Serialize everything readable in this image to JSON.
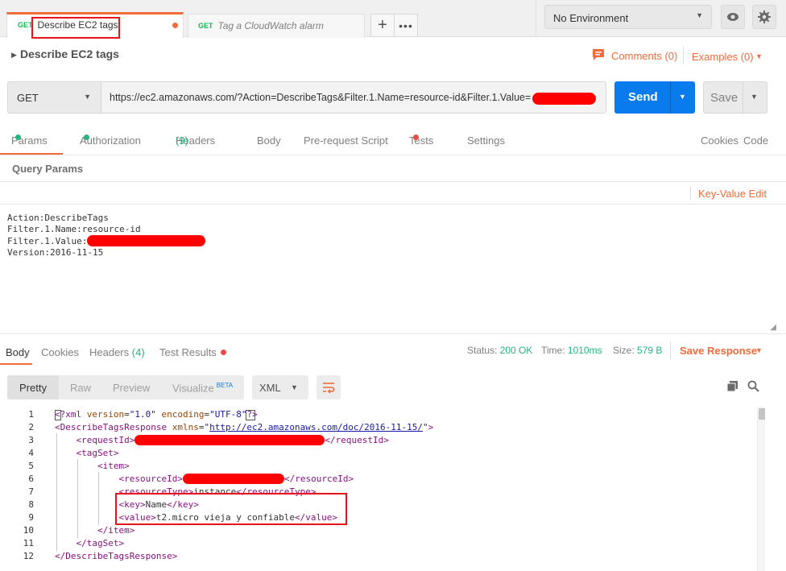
{
  "tabs": [
    {
      "method": "GET",
      "name": "Describe EC2 tags"
    },
    {
      "method": "GET",
      "name": "Tag a CloudWatch alarm"
    }
  ],
  "environment": {
    "selected": "No Environment"
  },
  "request": {
    "title": "Describe EC2 tags",
    "comments_label": "Comments (0)",
    "examples_label": "Examples (0)",
    "method": "GET",
    "url": "https://ec2.amazonaws.com/?Action=DescribeTags&Filter.1.Name=resource-id&Filter.1.Value=",
    "send_label": "Send",
    "save_label": "Save"
  },
  "request_tabs": {
    "params": "Params",
    "authorization": "Authorization",
    "headers": "Headers",
    "headers_count": "(9)",
    "body": "Body",
    "prerequest": "Pre-request Script",
    "tests": "Tests",
    "settings": "Settings",
    "cookies": "Cookies",
    "code": "Code"
  },
  "query_params": {
    "title": "Query Params",
    "key_value_edit": "Key-Value Edit",
    "bulk_lines": [
      "Action:DescribeTags",
      "Filter.1.Name:resource-id",
      "Filter.1.Value:",
      "Version:2016-11-15"
    ]
  },
  "response": {
    "tabs": {
      "body": "Body",
      "cookies": "Cookies",
      "headers": "Headers",
      "headers_count": "(4)",
      "test_results": "Test Results"
    },
    "status_label": "Status:",
    "status_value": "200 OK",
    "time_label": "Time:",
    "time_value": "1010ms",
    "size_label": "Size:",
    "size_value": "579 B",
    "save_response": "Save Response",
    "view_modes": {
      "pretty": "Pretty",
      "raw": "Raw",
      "preview": "Preview",
      "visualize": "Visualize",
      "beta": "BETA"
    },
    "format": "XML",
    "line_numbers": [
      "1",
      "2",
      "3",
      "4",
      "5",
      "6",
      "7",
      "8",
      "9",
      "10",
      "11",
      "12"
    ],
    "xml": {
      "decl_version_attr": "version",
      "decl_version": "\"1.0\"",
      "decl_enc_attr": "encoding",
      "decl_enc": "\"UTF-8\"",
      "root": "DescribeTagsResponse",
      "xmlns_attr": "xmlns",
      "xmlns_val": "http://ec2.amazonaws.com/doc/2016-11-15/",
      "request_id": "requestId",
      "tag_set": "tagSet",
      "item": "item",
      "resource_id": "resourceId",
      "resource_type": "resourceType",
      "resource_type_val": "instance",
      "key": "key",
      "key_val": "Name",
      "value": "value",
      "value_val": "t2.micro vieja y confiable"
    }
  }
}
